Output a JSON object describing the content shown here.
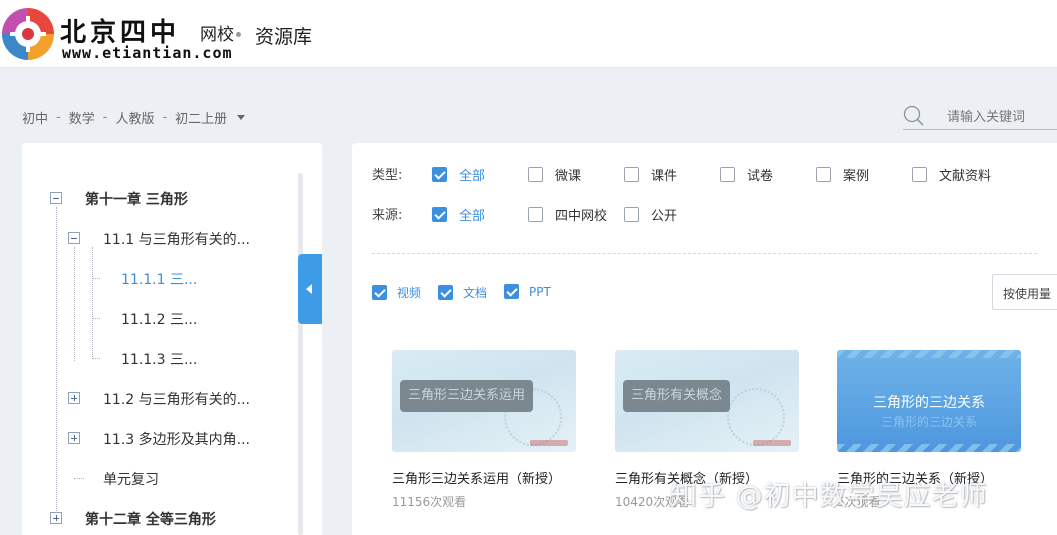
{
  "header": {
    "brand_cn": "北京四中",
    "brand_wx": "网校",
    "brand_url": "www.etiantian.com",
    "title": "资源库"
  },
  "breadcrumb": [
    "初中",
    "数学",
    "人教版",
    "初二上册"
  ],
  "breadcrumb_sep": "-",
  "search": {
    "placeholder": "请输入关键词"
  },
  "tree": {
    "chapter11": "第十一章 三角形",
    "s11_1": "11.1 与三角形有关的...",
    "s11_1_1": "11.1.1 三...",
    "s11_1_2": "11.1.2 三...",
    "s11_1_3": "11.1.3 三...",
    "s11_2": "11.2 与三角形有关的...",
    "s11_3": "11.3 多边形及其内角...",
    "review": "单元复习",
    "chapter12": "第十二章 全等三角形"
  },
  "filters": {
    "type_label": "类型:",
    "type_options": [
      "全部",
      "微课",
      "课件",
      "试卷",
      "案例",
      "文献资料"
    ],
    "source_label": "来源:",
    "source_options": [
      "全部",
      "四中网校",
      "公开"
    ],
    "format_options": [
      "视频",
      "文档",
      "PPT"
    ]
  },
  "sort": {
    "label": "按使用量"
  },
  "cards": [
    {
      "thumb_text": "三角形三边关系运用",
      "title": "三角形三边关系运用（新授）",
      "views": "11156次观看"
    },
    {
      "thumb_text": "三角形有关概念",
      "title": "三角形有关概念（新授）",
      "views": "10420次观看"
    },
    {
      "thumb_text": "三角形的三边关系",
      "thumb_sub": "三角形的三边关系",
      "title": "三角形的三边关系（新授）",
      "views": "5次观看"
    }
  ],
  "watermark": "知乎 @初中数学吴应老师",
  "colors": {
    "accent": "#3d8fe0",
    "tab": "#3e9be6"
  }
}
